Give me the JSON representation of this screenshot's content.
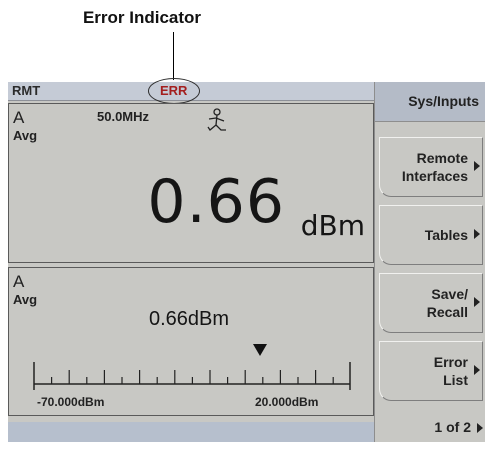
{
  "callout": {
    "label": "Error Indicator"
  },
  "status": {
    "remote": "RMT",
    "error": "ERR"
  },
  "upper_window": {
    "channel": "A",
    "mode": "Avg",
    "frequency": "50.0MHz",
    "value": "0.66",
    "unit": "dBm"
  },
  "lower_window": {
    "channel": "A",
    "mode": "Avg",
    "reading": "0.66dBm",
    "scale_min": "-70.000dBm",
    "scale_max": "20.000dBm"
  },
  "softkeys": {
    "menu_title": "Sys/Inputs",
    "items": [
      {
        "line1": "Remote",
        "line2": "Interfaces"
      },
      {
        "line1": "Tables",
        "line2": ""
      },
      {
        "line1": "Save/",
        "line2": "Recall"
      },
      {
        "line1": "Error",
        "line2": "List"
      }
    ],
    "page": "1 of 2"
  },
  "colors": {
    "error_text": "#a41f1f",
    "accent_bar": "#3a5fa7",
    "screen_bg": "#c8c8c4"
  }
}
